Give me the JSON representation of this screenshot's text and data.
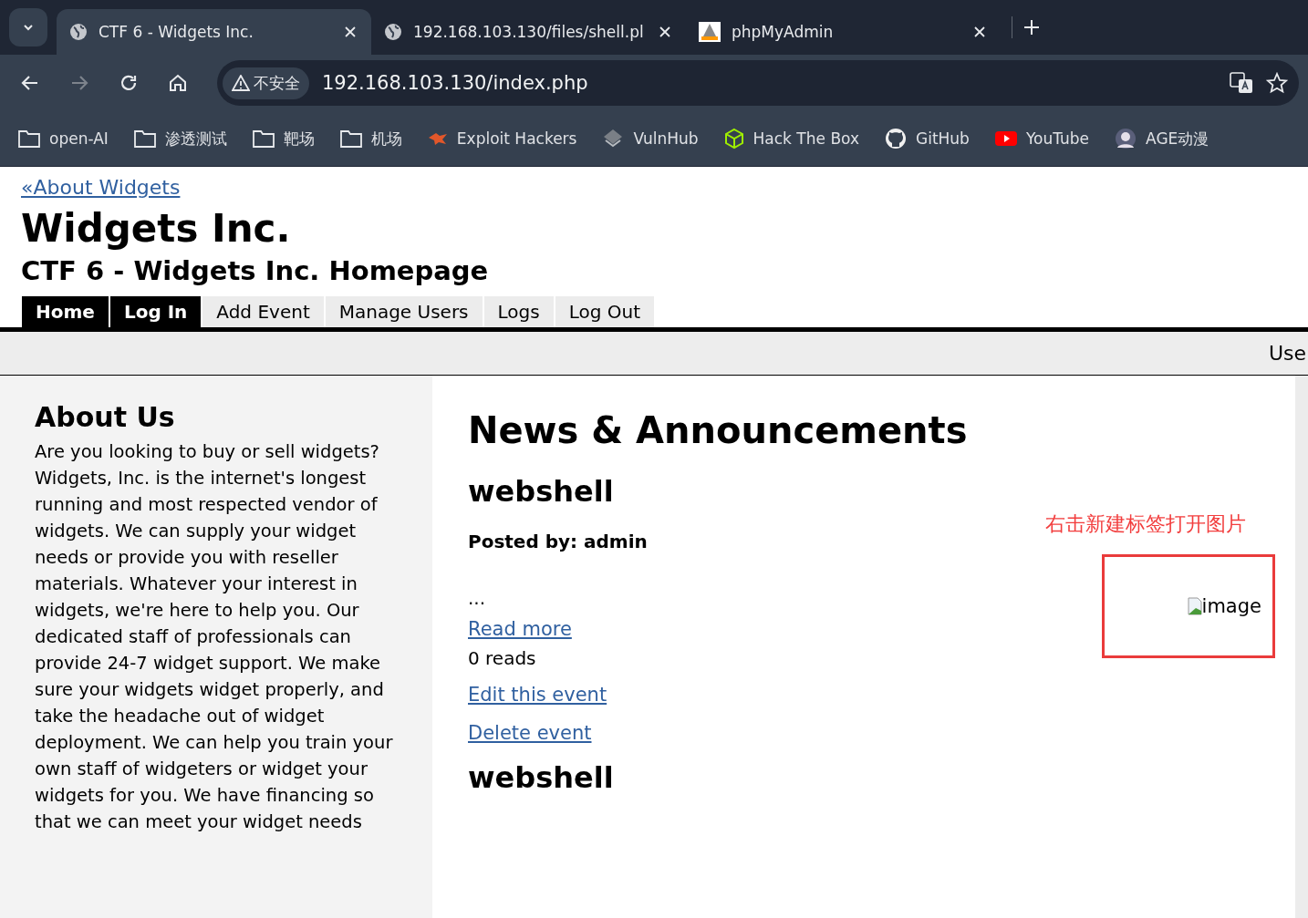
{
  "browser": {
    "tabs": [
      {
        "title": "CTF 6 - Widgets Inc.",
        "kind": "globe",
        "selected": true
      },
      {
        "title": "192.168.103.130/files/shell.pl",
        "kind": "globe",
        "selected": false
      },
      {
        "title": "phpMyAdmin",
        "kind": "app",
        "selected": false
      }
    ],
    "security_label": "不安全",
    "url": "192.168.103.130/index.php",
    "bookmarks": [
      {
        "label": "open-AI",
        "kind": "folder"
      },
      {
        "label": "渗透测试",
        "kind": "folder"
      },
      {
        "label": "靶场",
        "kind": "folder"
      },
      {
        "label": "机场",
        "kind": "folder"
      },
      {
        "label": "Exploit Hackers",
        "kind": "site"
      },
      {
        "label": "VulnHub",
        "kind": "site"
      },
      {
        "label": "Hack The Box",
        "kind": "site"
      },
      {
        "label": "GitHub",
        "kind": "site"
      },
      {
        "label": "YouTube",
        "kind": "site"
      },
      {
        "label": "AGE动漫",
        "kind": "site"
      }
    ]
  },
  "page": {
    "back_link": "«About Widgets",
    "title": "Widgets Inc.",
    "subtitle": "CTF 6 - Widgets Inc. Homepage",
    "nav": [
      {
        "label": "Home",
        "highlighted": true
      },
      {
        "label": "Log In",
        "highlighted": true
      },
      {
        "label": "Add Event",
        "highlighted": false
      },
      {
        "label": "Manage Users",
        "highlighted": false
      },
      {
        "label": "Logs",
        "highlighted": false
      },
      {
        "label": "Log Out",
        "highlighted": false
      }
    ],
    "status_text": "Use",
    "sidebar": {
      "heading": "About Us",
      "text": "Are you looking to buy or sell widgets? Widgets, Inc. is the internet's longest running and most respected vendor of widgets. We can supply your widget needs or provide you with reseller materials. Whatever your interest in widgets, we're here to help you. Our dedicated staff of professionals can provide 24-7 widget support. We make sure your widgets widget properly, and take the headache out of widget deployment. We can help you train your own staff of widgeters or widget your widgets for you. We have financing so that we can meet your widget needs"
    },
    "main": {
      "heading": "News & Announcements",
      "posts": [
        {
          "title": "webshell",
          "posted_by": "Posted by: admin",
          "excerpt": "...",
          "read_more": "Read more",
          "reads": "0 reads",
          "edit_link": "Edit this event",
          "delete_link": "Delete event",
          "image_alt": "image",
          "annotation": "右击新建标签打开图片"
        },
        {
          "title": "webshell"
        }
      ]
    }
  }
}
